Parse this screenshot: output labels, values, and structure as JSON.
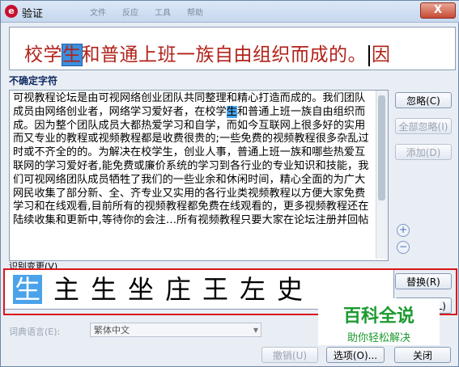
{
  "window": {
    "title": "验证",
    "ghost_titles": [
      "文件",
      "反应",
      "工具",
      "帮助"
    ],
    "close_label": "X"
  },
  "preview": {
    "before": "校学",
    "highlight": "生",
    "after": "和普通上班一族自由组织而成的。",
    "trailing": "因"
  },
  "uncertain_label": "不确定字符",
  "document": {
    "before": "可视教程论坛是由可视网络创业团队共同整理和精心打造而成的。我们团队成员由网络创业者，网络学习爱好者，在校学",
    "highlight": "生",
    "after": "和普通上班一族自由组织而成。因为整个团队成员大都热爱学习和自学，而如今互联网上很多好的实用而又专业的教程或视频教程都是收费很贵的;一些免费的视频教程很多杂乱过时或不齐全的的。为解决在校学生，创业人事，普通上班一族和哪些热爱互联网的学习爱好者,能免费或廉价系统的学习到各行业的专业知识和技能，我们可视网络团队成员牺牲了我们的一些业余和休闲时间，精心全面的为广大网民收集了部分新、全、齐专业又实用的各行业类视频教程以方便大家免费学习和在线观看,目前所有的视频教程都免费在线观看的，更多视频教程还在陆续收集和更新中,等待你的会注…所有视频教程只要大家在论坛注册并回帖"
  },
  "buttons": {
    "ignore": "忽略(C)",
    "ignore_all": "全部忽略(I)",
    "add": "添加(D)",
    "replace": "替换(R)",
    "replace_all": "L)",
    "undo": "撤销(U)",
    "options": "选项(O)...",
    "close": "关闭"
  },
  "zoom": {
    "plus": "+",
    "minus": "−"
  },
  "suggestions_label": "识别变更(V)",
  "suggestions": [
    "生",
    "主",
    "生",
    "坐",
    "庄",
    "王",
    "左",
    "史"
  ],
  "dictionary": {
    "label": "词典语言(E):",
    "value": "繁体中文"
  },
  "watermark": {
    "title": "百科全说",
    "subtitle": "助你轻松解决"
  }
}
